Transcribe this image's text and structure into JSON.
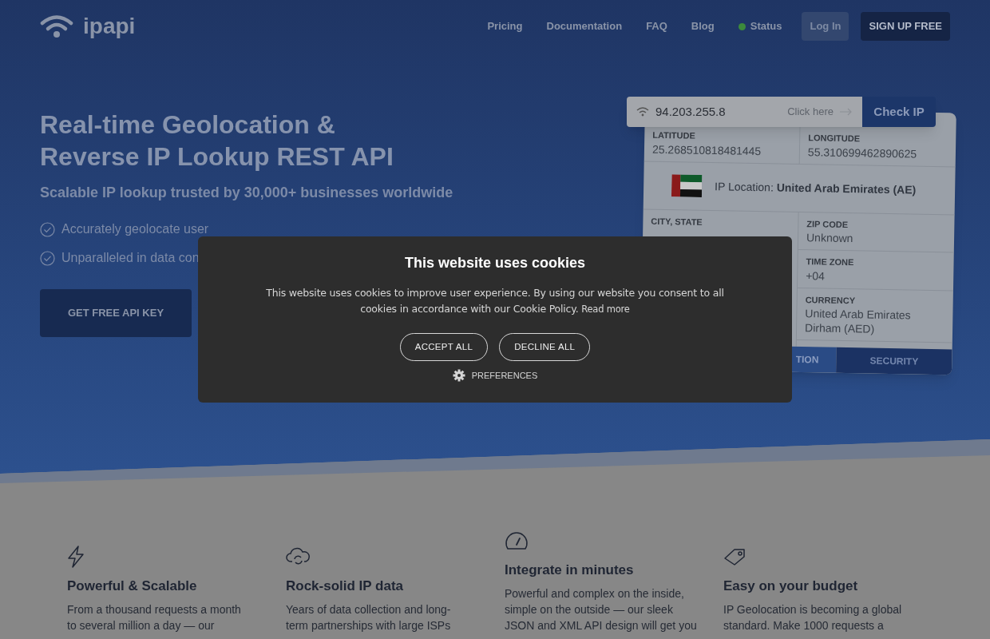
{
  "header": {
    "logo": "ipapi",
    "nav": [
      {
        "label": "Pricing",
        "kind": "link"
      },
      {
        "label": "Documentation",
        "kind": "link"
      },
      {
        "label": "FAQ",
        "kind": "link"
      },
      {
        "label": "Blog",
        "kind": "link"
      },
      {
        "label": "Status",
        "kind": "status",
        "color": "#3c8a3c"
      }
    ],
    "login": "Log In",
    "signup": "SIGN UP FREE"
  },
  "hero": {
    "title_lines": [
      "Real-time Geolocation &",
      "Reverse IP Lookup REST API"
    ],
    "subtitle": "Scalable IP lookup trusted by 30,000+ businesses worldwide",
    "bullets": [
      "Accurately geolocate user",
      "Unparalleled in data con"
    ],
    "cta": "GET FREE API KEY"
  },
  "lookup": {
    "ip": "94.203.255.8",
    "hint": "Click here",
    "button": "Check IP",
    "top": [
      {
        "label": "LATITUDE",
        "value": "25.268510818481445"
      },
      {
        "label": "LONGITUDE",
        "value": "55.310699462890625"
      }
    ],
    "location_label": "IP Location:",
    "location_value": "United Arab Emirates (AE)",
    "left": [
      {
        "label": "CITY, STATE"
      }
    ],
    "right": [
      {
        "label": "ZIP CODE",
        "value": "Unknown"
      },
      {
        "label": "TIME ZONE",
        "value": "+04"
      },
      {
        "label": "CURRENCY",
        "value": "United Arab Emirates Dirham (AED)"
      }
    ],
    "tabs": [
      {
        "label": "TION",
        "selected": true
      },
      {
        "label": "SECURITY",
        "selected": false
      }
    ]
  },
  "cookie": {
    "title": "This website uses cookies",
    "text": "This website uses cookies to improve user experience. By using our website you consent to all cookies in accordance with our Cookie Policy.",
    "link": "Read more",
    "buttons": [
      "ACCEPT ALL",
      "DECLINE ALL"
    ],
    "preferences": "PREFERENCES"
  },
  "features": [
    {
      "kind": "bolt",
      "title": "Powerful & Scalable",
      "lines": [
        "From a thousand requests a month",
        "to several million a day — our"
      ]
    },
    {
      "kind": "cloud",
      "title": "Rock-solid IP data",
      "lines": [
        "Years of data collection and long-",
        "term partnerships with large ISPs"
      ]
    },
    {
      "kind": "gauge",
      "title": "Integrate in minutes",
      "lines": [
        "Powerful and complex on the inside,",
        "simple on the outside — our sleek",
        "JSON and XML API design will get you"
      ]
    },
    {
      "kind": "tag",
      "title": "Easy on your budget",
      "lines": [
        "IP Geolocation is becoming a global",
        "standard. Make 1000 requests a"
      ]
    }
  ]
}
